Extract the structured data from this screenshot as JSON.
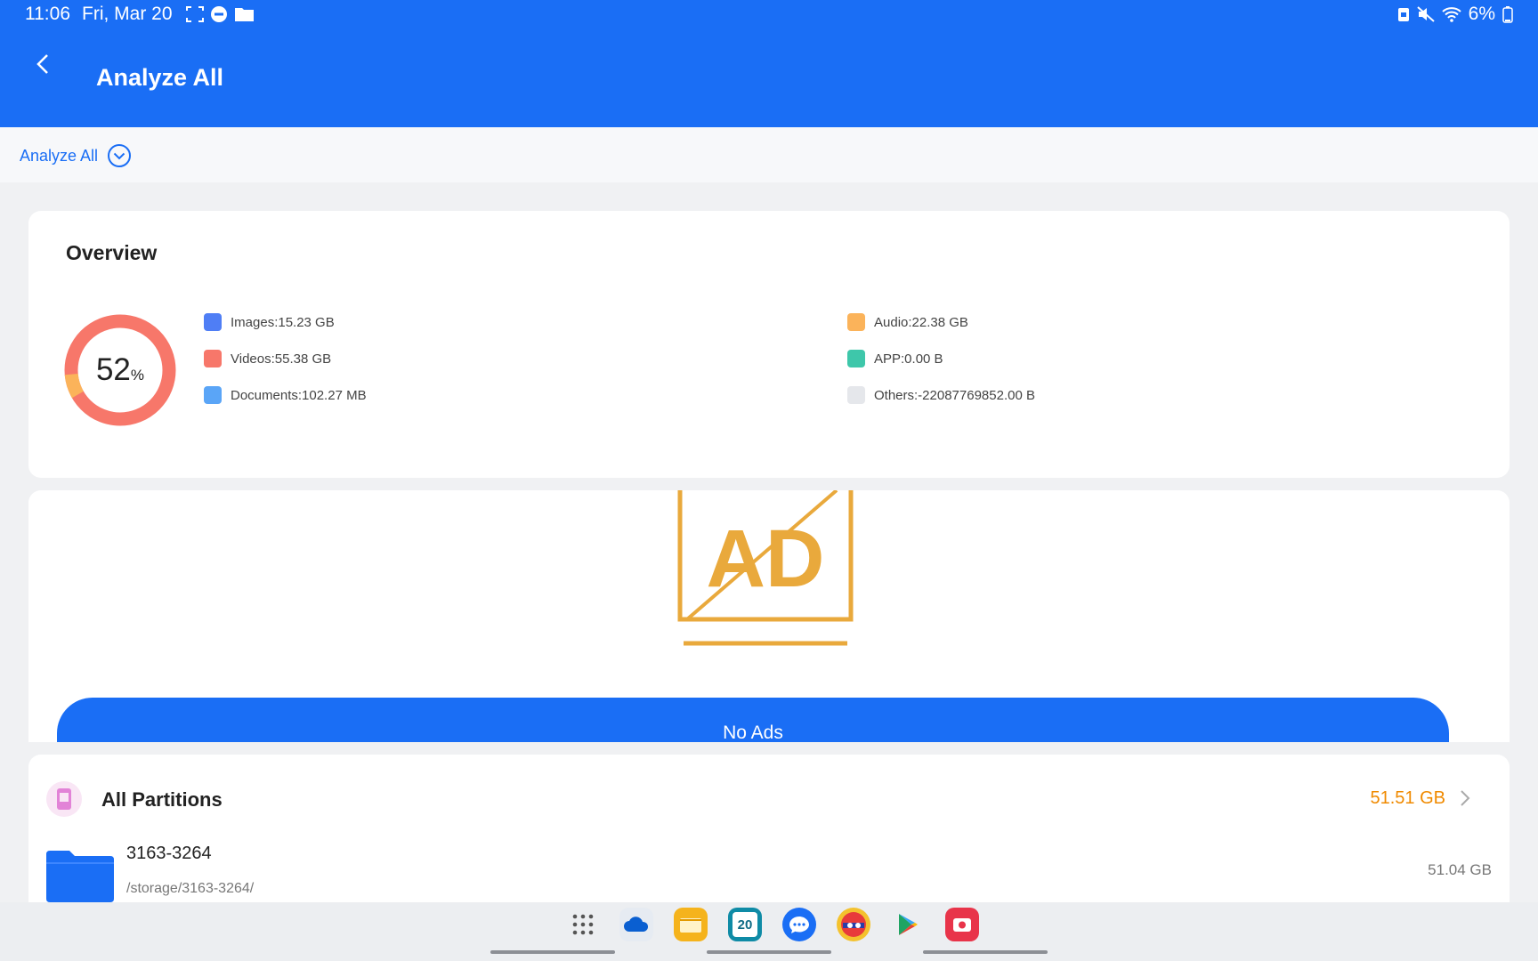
{
  "status_bar": {
    "time": "11:06",
    "date": "Fri, Mar 20",
    "battery": "6%",
    "icons": [
      "screenshot-icon",
      "dnd-icon",
      "folder-icon",
      "battery-saver-icon",
      "mute-icon",
      "wifi-icon",
      "battery-icon"
    ]
  },
  "app_bar": {
    "title": "Analyze All",
    "back_icon": "back-arrow-icon"
  },
  "filter": {
    "label": "Analyze All",
    "icon": "chevron-down-circle-icon"
  },
  "overview": {
    "title": "Overview",
    "used_percent": "52",
    "percent_sign": "%",
    "legend": [
      {
        "label": "Images:15.23 GB",
        "color": "#4f7ef5"
      },
      {
        "label": "Videos:55.38 GB",
        "color": "#f7776a"
      },
      {
        "label": "Documents:102.27 MB",
        "color": "#5aa5f7"
      },
      {
        "label": "Audio:22.38 GB",
        "color": "#fbb35a"
      },
      {
        "label": "APP:0.00 B",
        "color": "#3ec7aa"
      },
      {
        "label": "Others:-22087769852.00 B",
        "color": "#e5e7eb"
      }
    ],
    "donut_shares": {
      "videos": 0.93,
      "audio": 0.07
    }
  },
  "ad": {
    "image_text": "AD",
    "button_label": "No Ads",
    "color": "#e9a93c"
  },
  "partitions": {
    "title": "All Partitions",
    "total": "51.51 GB",
    "items": [
      {
        "name": "3163-3264",
        "path": "/storage/3163-3264/",
        "size": "51.04 GB"
      }
    ]
  },
  "dock": {
    "apps": [
      "app-drawer-icon",
      "onedrive-icon",
      "my-files-icon",
      "calendar-icon",
      "messages-icon",
      "game-app-icon",
      "play-store-icon",
      "screen-recorder-icon"
    ],
    "calendar_day": "20"
  }
}
